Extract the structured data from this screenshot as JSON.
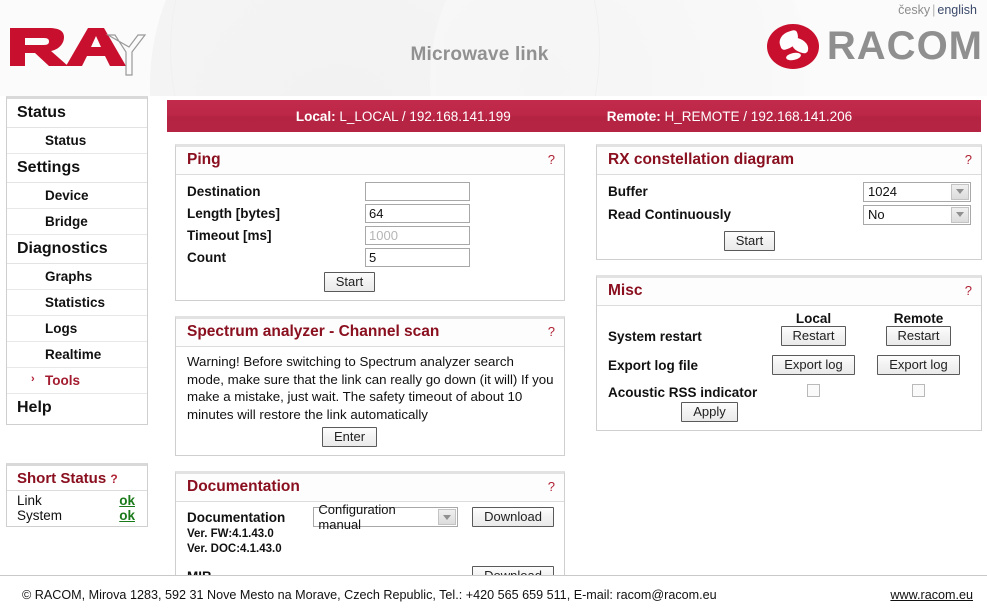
{
  "header": {
    "lang_cesky": "česky",
    "lang_sep": "|",
    "lang_english": "english",
    "title": "Microwave link",
    "logo_ray": "RAy",
    "logo_racom": "RACOM"
  },
  "banner": {
    "local_label": "Local:",
    "local_value": "L_LOCAL / 192.168.141.199",
    "remote_label": "Remote:",
    "remote_value": "H_REMOTE / 192.168.141.206"
  },
  "sidebar": {
    "groups": [
      {
        "head": "Status",
        "items": [
          {
            "label": "Status",
            "active": false
          }
        ]
      },
      {
        "head": "Settings",
        "items": [
          {
            "label": "Device",
            "active": false
          },
          {
            "label": "Bridge",
            "active": false
          }
        ]
      },
      {
        "head": "Diagnostics",
        "items": [
          {
            "label": "Graphs",
            "active": false
          },
          {
            "label": "Statistics",
            "active": false
          },
          {
            "label": "Logs",
            "active": false
          },
          {
            "label": "Realtime",
            "active": false
          },
          {
            "label": "Tools",
            "active": true
          }
        ]
      },
      {
        "head": "Help",
        "items": []
      }
    ],
    "active_marker": "›"
  },
  "short_status": {
    "title": "Short Status",
    "help": "?",
    "rows": [
      {
        "label": "Link",
        "value": "ok"
      },
      {
        "label": "System",
        "value": "ok"
      }
    ]
  },
  "ping": {
    "title": "Ping",
    "help": "?",
    "destination_label": "Destination",
    "destination_value": "",
    "destination_placeholder": "",
    "length_label": "Length [bytes]",
    "length_value": "64",
    "timeout_label": "Timeout [ms]",
    "timeout_value": "",
    "timeout_placeholder": "1000",
    "count_label": "Count",
    "count_value": "5",
    "start_button": "Start"
  },
  "spectrum": {
    "title": "Spectrum analyzer - Channel scan",
    "help": "?",
    "warning": "Warning! Before switching to Spectrum analyzer search mode, make sure that the link can really go down (it will) If you make a mistake, just wait. The safety timeout of about 10 minutes will restore the link automatically",
    "enter_button": "Enter"
  },
  "documentation": {
    "title": "Documentation",
    "help": "?",
    "doc_label": "Documentation",
    "doc_selected": "Configuration manual",
    "doc_options": [
      "Configuration manual"
    ],
    "download_button": "Download",
    "ver_fw": "Ver. FW:4.1.43.0",
    "ver_doc": "Ver. DOC:4.1.43.0",
    "mib_label": "MIB",
    "mib_download_button": "Download"
  },
  "rx_constellation": {
    "title": "RX constellation diagram",
    "help": "?",
    "buffer_label": "Buffer",
    "buffer_selected": "1024",
    "buffer_options": [
      "1024"
    ],
    "read_label": "Read Continuously",
    "read_selected": "No",
    "read_options": [
      "No"
    ],
    "start_button": "Start"
  },
  "misc": {
    "title": "Misc",
    "help": "?",
    "col_local": "Local",
    "col_remote": "Remote",
    "restart_label": "System restart",
    "restart_local_button": "Restart",
    "restart_remote_button": "Restart",
    "export_label": "Export log file",
    "export_local_button": "Export log",
    "export_remote_button": "Export log",
    "acoustic_label": "Acoustic RSS indicator",
    "apply_button": "Apply"
  },
  "footer": {
    "text": "© RACOM, Mirova 1283, 592 31 Nove Mesto na Morave, Czech Republic, Tel.: +420 565 659 511, E-mail: racom@racom.eu",
    "link": "www.racom.eu"
  },
  "colors": {
    "brand_red": "#c8102e",
    "banner_red": "#bd2747",
    "heading_red": "#8a1020",
    "status_green": "#1a7a1a"
  }
}
